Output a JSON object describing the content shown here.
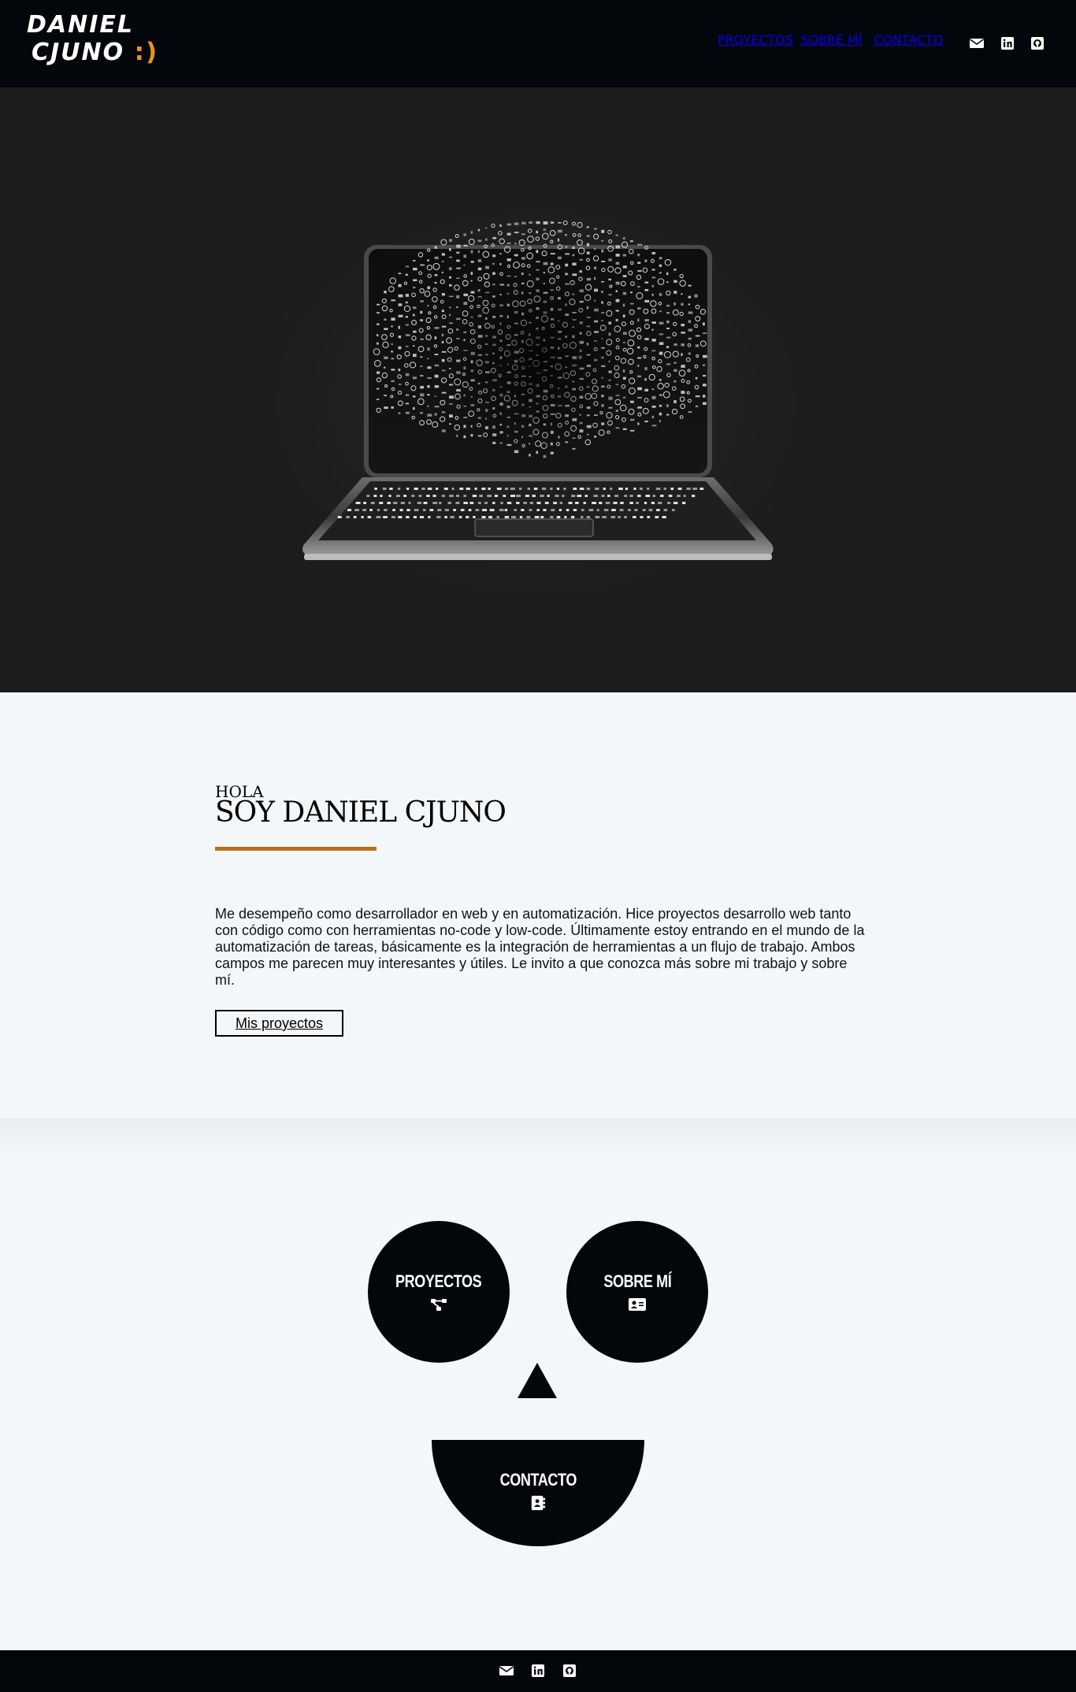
{
  "header": {
    "logo_line1": "DANIEL",
    "logo_line2": "CJUNO",
    "logo_smile": ":)",
    "nav": [
      "PROYECTOS",
      "SOBRE MÍ",
      "CONTACTO"
    ],
    "social_icons": [
      "envelope-icon",
      "linkedin-icon",
      "github-icon"
    ]
  },
  "hero": {
    "image": "laptop-code-illustration"
  },
  "intro": {
    "greeting": "HOLA",
    "title": "SOY DANIEL CJUNO",
    "bio": "Me desempeño como desarrollador en web y en automatización. Hice proyectos desarrollo web tanto con código como con herramientas no-code y low-code. Últimamente estoy entrando en el mundo de la automatización de tareas, básicamente es la integración de herramientas a un flujo de trabajo. Ambos campos me parecen muy interesantes y útiles. Le invito a que conozca más sobre mi trabajo y sobre mí.",
    "button": "Mis proyectos"
  },
  "face": {
    "left_eye": "PROYECTOS",
    "right_eye": "SOBRE MÍ",
    "mouth": "CONTACTO"
  },
  "colors": {
    "header_bg": "#03060b",
    "accent": "#b6721e",
    "smile": "#e8941f",
    "hero_bg": "#1c1c1c",
    "page_bg": "#f4f7fa"
  }
}
